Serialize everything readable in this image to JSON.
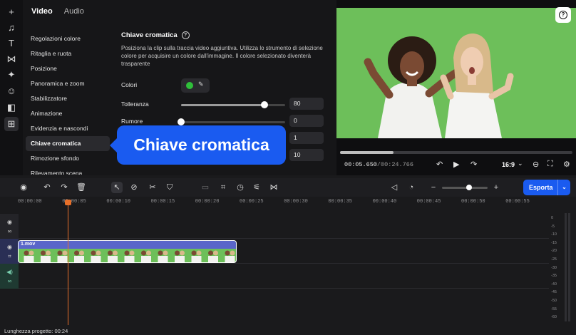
{
  "rail": {
    "icons": [
      "plus-icon",
      "music-icon",
      "text-icon",
      "transitions-icon",
      "effects-icon",
      "sticker-icon",
      "templates-icon",
      "tools-icon"
    ]
  },
  "panel": {
    "tabs": [
      {
        "label": "Video",
        "active": true
      },
      {
        "label": "Audio",
        "active": false
      }
    ],
    "menu": [
      "Regolazioni colore",
      "Ritaglia e ruota",
      "Posizione",
      "Panoramica e zoom",
      "Stabilizzatore",
      "Animazione",
      "Evidenzia e nascondi",
      "Chiave cromatica",
      "Rimozione sfondo",
      "Rilevamento scena"
    ],
    "menu_selected": "Chiave cromatica",
    "title": "Chiave cromatica",
    "description": "Posiziona la clip sulla traccia video aggiuntiva. Utilizza lo strumento di selezione colore per acquisire un colore dall'immagine. Il colore selezionato diventerà trasparente",
    "color_label": "Colori",
    "key_color": "#2fbf3a",
    "tolerance": {
      "label": "Tolleranza",
      "value": "80",
      "fraction": 0.8
    },
    "noise": {
      "label": "Rumore",
      "value": "0",
      "fraction": 0.0
    },
    "field3": {
      "value": "1"
    },
    "field4": {
      "value": "10"
    }
  },
  "callout": {
    "text": "Chiave cromatica",
    "color": "#1a5bf0"
  },
  "preview": {
    "timecode_current": "00:05.650",
    "timecode_total": "00:24.766",
    "progress_fraction": 0.23,
    "aspect_ratio": "16:9",
    "help": "?",
    "screen_color": "#6dbf5a"
  },
  "toolbar": {
    "export_label": "Esporta",
    "zoom_fraction": 0.6
  },
  "ruler": [
    "00:00:00",
    "00:00:05",
    "00:00:10",
    "00:00:15",
    "00:00:20",
    "00:00:25",
    "00:00:30",
    "00:00:35",
    "00:00:40",
    "00:00:45",
    "00:00:50",
    "00:00:55"
  ],
  "clip": {
    "name": "1.mov"
  },
  "meter": [
    "0",
    "-5",
    "-10",
    "-15",
    "-20",
    "-25",
    "-30",
    "-35",
    "-40",
    "-45",
    "-50",
    "-55",
    "-60"
  ],
  "footer": "Lunghezza progetto: 00:24"
}
